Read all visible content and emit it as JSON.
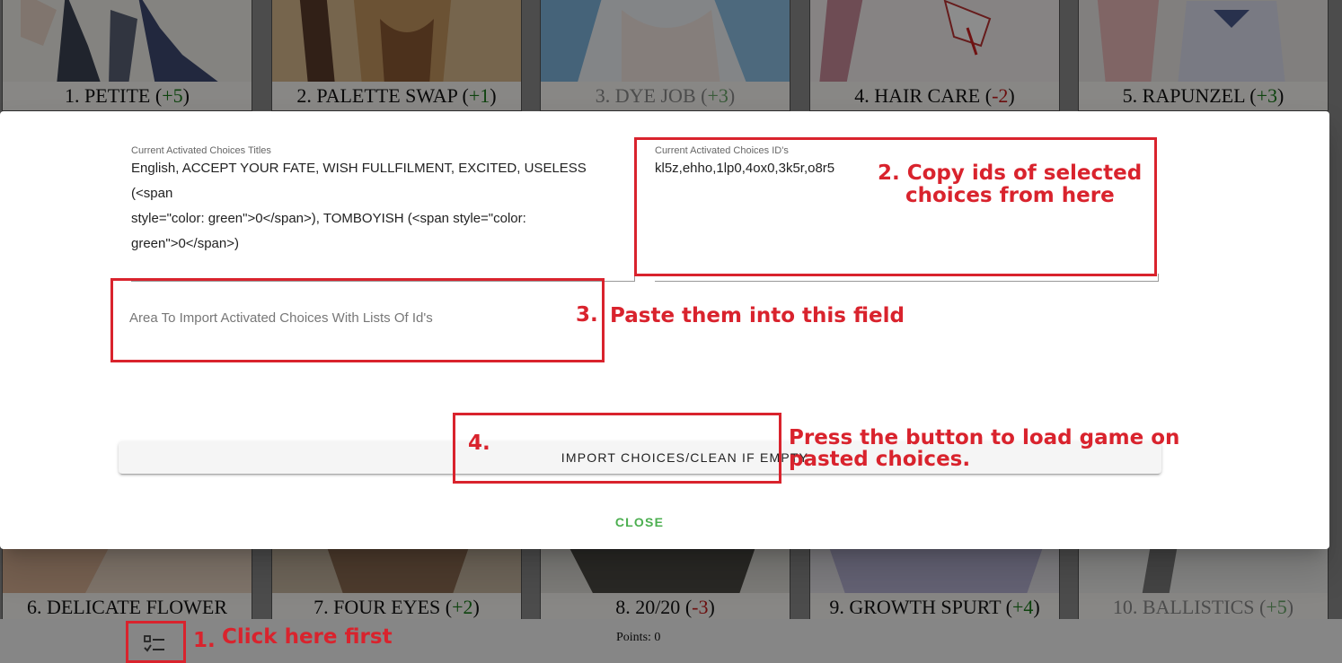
{
  "cards_top": [
    {
      "name": "1. PETITE",
      "mod": "+5",
      "sign": "pos",
      "dim": false
    },
    {
      "name": "2. PALETTE SWAP",
      "mod": "+1",
      "sign": "pos",
      "dim": false
    },
    {
      "name": "3. DYE JOB",
      "mod": "+3",
      "sign": "pos",
      "dim": true
    },
    {
      "name": "4. HAIR CARE",
      "mod": "-2",
      "sign": "neg",
      "dim": false
    },
    {
      "name": "5. RAPUNZEL",
      "mod": "+3",
      "sign": "pos",
      "dim": false
    }
  ],
  "cards_bottom": [
    {
      "name": "6. DELICATE FLOWER",
      "mod": "",
      "sign": "pos",
      "dim": false
    },
    {
      "name": "7. FOUR EYES",
      "mod": "+2",
      "sign": "pos",
      "dim": false
    },
    {
      "name": "8. 20/20",
      "mod": "-3",
      "sign": "neg",
      "dim": false
    },
    {
      "name": "9. GROWTH SPURT",
      "mod": "+4",
      "sign": "pos",
      "dim": false
    },
    {
      "name": "10. BALLISTICS",
      "mod": "+5",
      "sign": "pos",
      "dim": true
    }
  ],
  "dialog": {
    "titles_label": "Current Activated Choices Titles",
    "titles_lines": [
      "English, ACCEPT YOUR FATE, WISH FULLFILMENT, EXCITED, USELESS (<span",
      "style=\"color: green\">0</span>), TOMBOYISH (<span style=\"color:",
      "green\">0</span>)"
    ],
    "ids_label": "Current Activated Choices ID's",
    "ids_value": "kl5z,ehho,1lp0,4ox0,3k5r,o8r5",
    "import_placeholder": "Area To Import Activated Choices With Lists Of Id's",
    "import_button": "IMPORT CHOICES/CLEAN IF EMPTY",
    "close_button": "CLOSE"
  },
  "footer": {
    "points": "Points: 0",
    "menu_icon": "checklist-icon"
  },
  "annotations": {
    "step1": "1.",
    "step1_text": "Click here first",
    "step2_line1": "2. Copy ids of selected",
    "step2_line2": "choices from here",
    "step3": "3.",
    "step3_text": "Paste them into this field",
    "step4": "4.",
    "step4_line1": "Press the button to load game on",
    "step4_line2": "pasted choices."
  },
  "colors": {
    "annotation_red": "#d9232d",
    "positive_green": "#1a7a1a",
    "negative_red": "#c41a1a",
    "close_green": "#4caf50"
  }
}
